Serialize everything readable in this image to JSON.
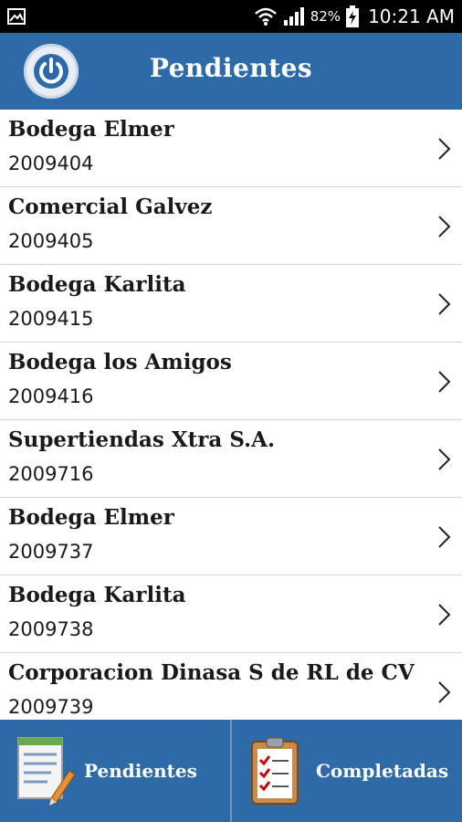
{
  "status_bar": {
    "battery_percent": "82%",
    "time": "10:21 AM"
  },
  "header": {
    "title": "Pendientes"
  },
  "items": [
    {
      "name": "Bodega Elmer",
      "code": "2009404"
    },
    {
      "name": "Comercial Galvez",
      "code": "2009405"
    },
    {
      "name": "Bodega Karlita",
      "code": "2009415"
    },
    {
      "name": "Bodega los Amigos",
      "code": "2009416"
    },
    {
      "name": "Supertiendas Xtra S.A.",
      "code": "2009716"
    },
    {
      "name": "Bodega Elmer",
      "code": "2009737"
    },
    {
      "name": "Bodega Karlita",
      "code": "2009738"
    },
    {
      "name": "Corporacion Dinasa S de RL de CV",
      "code": "2009739"
    }
  ],
  "tabs": {
    "pending_label": "Pendientes",
    "completed_label": "Completadas"
  },
  "colors": {
    "primary": "#2f6aa8",
    "status_bar": "#000000"
  }
}
